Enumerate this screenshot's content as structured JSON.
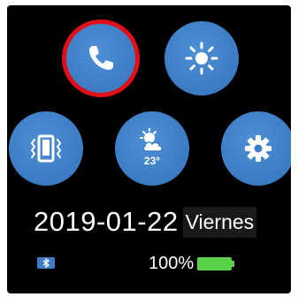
{
  "watch": {
    "apps": [
      {
        "name": "phone",
        "icon": "phone-icon",
        "selected": true
      },
      {
        "name": "brightness",
        "icon": "sun-icon",
        "selected": false
      },
      {
        "name": "vibration",
        "icon": "vibrate-icon",
        "selected": false
      },
      {
        "name": "weather",
        "icon": "weather-icon",
        "temperature": "23°",
        "selected": false
      },
      {
        "name": "settings",
        "icon": "gear-icon",
        "selected": false
      }
    ],
    "date": "2019-01-22",
    "day": "Viernes",
    "battery": {
      "percent_label": "100%",
      "level": 1.0
    },
    "bluetooth_icon": "bluetooth-icon",
    "colors": {
      "screen": "#000000",
      "button": "#3f7fc6",
      "highlight": "#e0101a",
      "battery": "#59d14a"
    }
  }
}
